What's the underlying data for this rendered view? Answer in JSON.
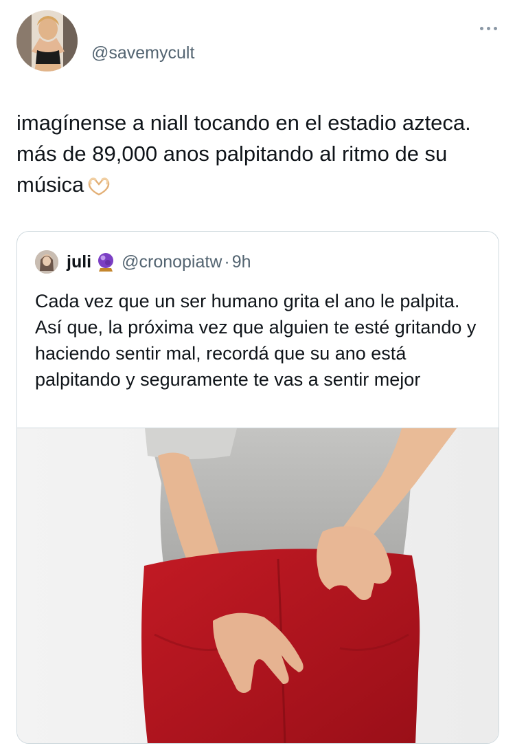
{
  "author": {
    "handle": "@savemycult",
    "avatar_icon": "profile-photo"
  },
  "tweet": {
    "text": "imagínense a niall tocando en el estadio azteca. más de 89,000 anos palpitando al ritmo de su música",
    "emoji": "heart-hands-emoji"
  },
  "quoted_tweet": {
    "name": "juli",
    "badge_icon": "crystal-ball-emoji",
    "handle": "@cronopiatw",
    "separator": "·",
    "time": "9h",
    "text": "Cada vez que un ser humano grita el ano le palpita. Así que, la próxima vez que alguien te esté gritando y haciendo sentir mal, recordá que su ano está palpitando y seguramente te vas a sentir mejor",
    "media": "photo-person-gray-shirt-red-pants"
  },
  "colors": {
    "text": "#0f1419",
    "secondary": "#536471",
    "border": "#cfd9de",
    "pants": "#b3141e",
    "shirt": "#b9b9b7"
  }
}
